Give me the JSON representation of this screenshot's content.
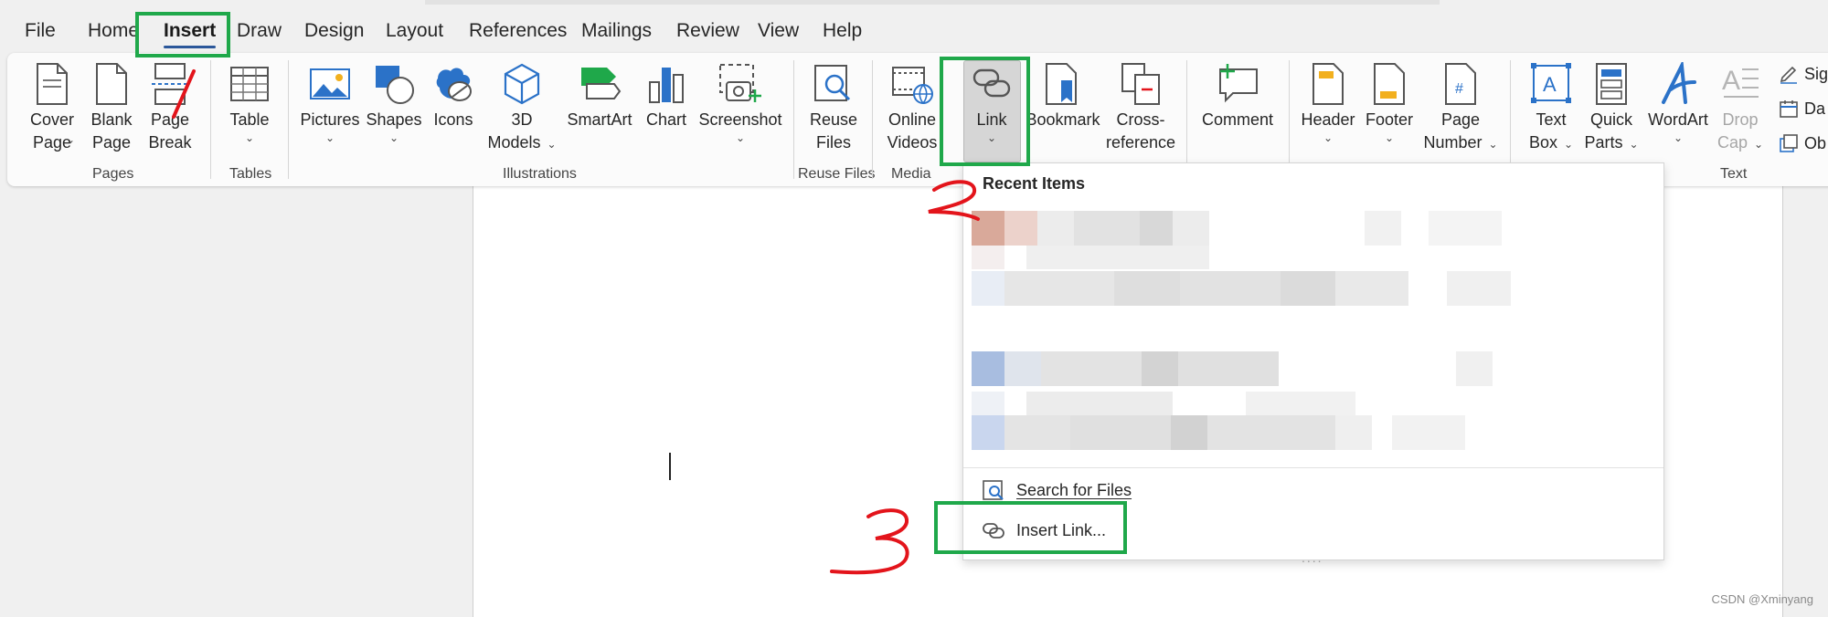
{
  "menu": {
    "tabs": [
      "File",
      "Home",
      "Insert",
      "Draw",
      "Design",
      "Layout",
      "References",
      "Mailings",
      "Review",
      "View",
      "Help"
    ],
    "active_tab": "Insert"
  },
  "ribbon": {
    "pages": {
      "label": "Pages",
      "cover_page": "Cover Page",
      "blank_page": "Blank Page",
      "page_break": "Page Break"
    },
    "tables": {
      "label": "Tables",
      "table": "Table"
    },
    "illustrations": {
      "label": "Illustrations",
      "pictures": "Pictures",
      "shapes": "Shapes",
      "icons": "Icons",
      "models_3d": "3D Models",
      "smartart": "SmartArt",
      "chart": "Chart",
      "screenshot": "Screenshot"
    },
    "reuse_files": {
      "label": "Reuse Files",
      "button": "Reuse Files"
    },
    "media": {
      "label": "Media",
      "online_videos": "Online Videos"
    },
    "links": {
      "link": "Link",
      "bookmark": "Bookmark",
      "cross_reference": "Cross-reference"
    },
    "comments": {
      "comment": "Comment"
    },
    "header_footer": {
      "header": "Header",
      "footer": "Footer",
      "page_number": "Page Number"
    },
    "text": {
      "label": "Text",
      "text_box": "Text Box",
      "quick_parts": "Quick Parts",
      "wordart": "WordArt",
      "drop_cap": "Drop Cap",
      "sig": "Sig",
      "da": "Da",
      "ob": "Ob"
    }
  },
  "link_dropdown": {
    "title": "Recent Items",
    "search_for_files": "Search for Files",
    "insert_link": "Insert Link...",
    "grip": "...."
  },
  "annotations": {
    "step_1": "1",
    "step_2": "2",
    "step_3": "3",
    "highlight_color": "#1fa84a",
    "ink_color": "#e3141b"
  },
  "watermark": "CSDN @Xminyang",
  "colors": {
    "accent": "#2b579a",
    "word_blue": "#2b72c8"
  }
}
